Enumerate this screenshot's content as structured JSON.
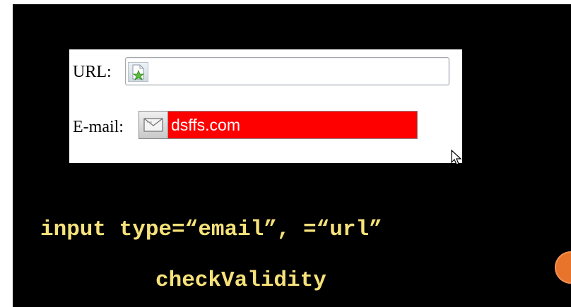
{
  "form": {
    "url_label": "URL:",
    "url_value": "",
    "email_label": "E-mail:",
    "email_value": "dsffs.com"
  },
  "captions": {
    "line1": "input type=“email”, =“url”",
    "line2": "checkValidity"
  },
  "icons": {
    "url": "url-page-icon",
    "email": "email-envelope-icon",
    "cursor": "mouse-pointer-icon",
    "decoration": "orange-circle"
  },
  "colors": {
    "slide_background": "#000000",
    "caption_text": "#f7e27a",
    "invalid_field": "#ff0000",
    "accent": "#e8742c"
  }
}
